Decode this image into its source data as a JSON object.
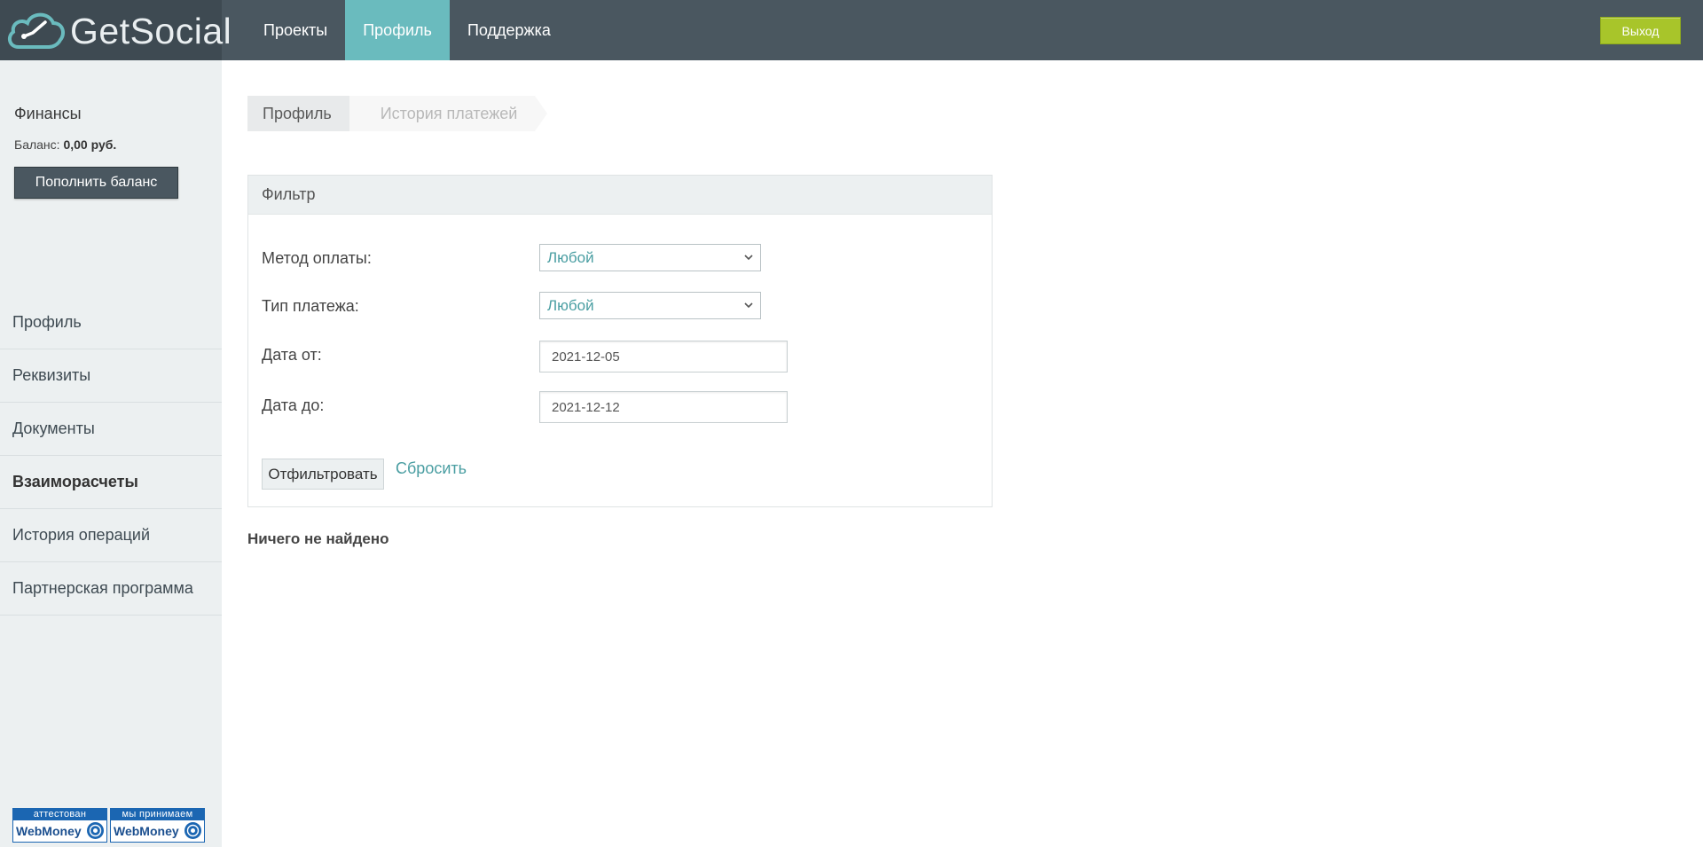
{
  "header": {
    "logo_text": "GetSocial",
    "nav": [
      {
        "label": "Проекты",
        "active": false
      },
      {
        "label": "Профиль",
        "active": true
      },
      {
        "label": "Поддержка",
        "active": false
      }
    ],
    "logout_label": "Выход"
  },
  "sidebar": {
    "finance_title": "Финансы",
    "balance_label": "Баланс:",
    "balance_value": "0,00 руб.",
    "topup_label": "Пополнить баланс",
    "menu": [
      {
        "label": "Профиль",
        "active": false
      },
      {
        "label": "Реквизиты",
        "active": false
      },
      {
        "label": "Документы",
        "active": false
      },
      {
        "label": "Взаиморасчеты",
        "active": true
      },
      {
        "label": "История операций",
        "active": false
      },
      {
        "label": "Партнерская программа",
        "active": false
      }
    ],
    "badges": [
      {
        "top": "аттестован",
        "bottom": "WebMoney"
      },
      {
        "top": "мы принимаем",
        "bottom": "WebMoney"
      }
    ]
  },
  "breadcrumb": {
    "items": [
      "Профиль",
      "История платежей"
    ]
  },
  "filter": {
    "title": "Фильтр",
    "payment_method_label": "Метод оплаты:",
    "payment_method_value": "Любой",
    "payment_type_label": "Тип платежа:",
    "payment_type_value": "Любой",
    "date_from_label": "Дата от:",
    "date_from_value": "2021-12-05",
    "date_to_label": "Дата до:",
    "date_to_value": "2021-12-12",
    "submit_label": "Отфильтровать",
    "reset_label": "Сбросить"
  },
  "results": {
    "empty_text": "Ничего не найдено"
  },
  "colors": {
    "topbar": "#4a5760",
    "accent": "#6abbbe",
    "logout": "#a8c52a",
    "link": "#4a9ea2"
  }
}
